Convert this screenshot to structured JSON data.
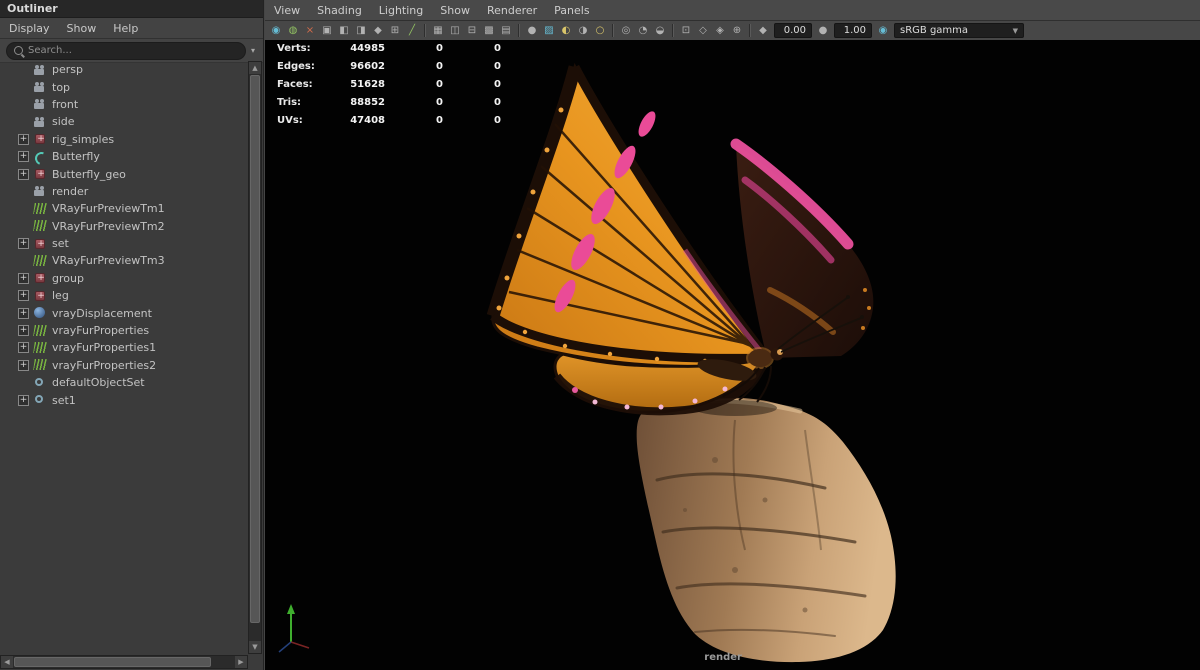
{
  "colors": {
    "ui_background": "#454545",
    "panel_background": "#3b3b3b",
    "input_background": "#242424",
    "viewport_background": "#000000",
    "text": "#c9c9c9",
    "butterfly_orange": "#e8951f",
    "butterfly_pink": "#e84f9b",
    "rock_tan": "#c9a277",
    "axis_green": "#3fae2e"
  },
  "glyphs": {
    "up": "▲",
    "down": "▼",
    "left": "◀",
    "right": "▶",
    "search_caret": "▾",
    "expander": "+",
    "dropdown_caret": "▼"
  },
  "outliner": {
    "title": "Outliner",
    "menus": [
      "Display",
      "Show",
      "Help"
    ],
    "search_placeholder": "Search...",
    "items": [
      {
        "label": "persp",
        "icon": "camera",
        "indent": 2,
        "expandable": false
      },
      {
        "label": "top",
        "icon": "camera",
        "indent": 2,
        "expandable": false
      },
      {
        "label": "front",
        "icon": "camera",
        "indent": 2,
        "expandable": false
      },
      {
        "label": "side",
        "icon": "camera",
        "indent": 2,
        "expandable": false
      },
      {
        "label": "rig_simples",
        "icon": "transform",
        "indent": 1,
        "expandable": true
      },
      {
        "label": "Butterfly",
        "icon": "curve",
        "indent": 1,
        "expandable": true
      },
      {
        "label": "Butterfly_geo",
        "icon": "transform",
        "indent": 1,
        "expandable": true
      },
      {
        "label": "render",
        "icon": "camera",
        "indent": 2,
        "expandable": false
      },
      {
        "label": "VRayFurPreviewTm1",
        "icon": "fur",
        "indent": 2,
        "expandable": false
      },
      {
        "label": "VRayFurPreviewTm2",
        "icon": "fur",
        "indent": 2,
        "expandable": false
      },
      {
        "label": "set",
        "icon": "transform",
        "indent": 1,
        "expandable": true
      },
      {
        "label": "VRayFurPreviewTm3",
        "icon": "fur",
        "indent": 2,
        "expandable": false
      },
      {
        "label": "group",
        "icon": "transform",
        "indent": 1,
        "expandable": true
      },
      {
        "label": "leg",
        "icon": "transform",
        "indent": 1,
        "expandable": true
      },
      {
        "label": "vrayDisplacement",
        "icon": "displacement",
        "indent": 1,
        "expandable": true
      },
      {
        "label": "vrayFurProperties",
        "icon": "fur",
        "indent": 1,
        "expandable": true
      },
      {
        "label": "vrayFurProperties1",
        "icon": "fur",
        "indent": 1,
        "expandable": true
      },
      {
        "label": "vrayFurProperties2",
        "icon": "fur",
        "indent": 1,
        "expandable": true
      },
      {
        "label": "defaultObjectSet",
        "icon": "objectset",
        "indent": 2,
        "expandable": false
      },
      {
        "label": "set1",
        "icon": "objectset",
        "indent": 1,
        "expandable": true
      }
    ]
  },
  "viewport": {
    "menus": [
      "View",
      "Shading",
      "Lighting",
      "Show",
      "Renderer",
      "Panels"
    ],
    "toolbar": [
      {
        "t": "icon",
        "name": "renderer-sphere-icon",
        "glyph": "◉",
        "c": "teal"
      },
      {
        "t": "icon",
        "name": "smooth-shade-icon",
        "glyph": "◍",
        "c": "green"
      },
      {
        "t": "icon",
        "name": "no-texture-icon",
        "glyph": "×",
        "c": "red"
      },
      {
        "t": "icon",
        "name": "select-camera-icon",
        "glyph": "▣"
      },
      {
        "t": "icon",
        "name": "lock-camera-icon",
        "glyph": "◧"
      },
      {
        "t": "icon",
        "name": "image-plane-icon",
        "glyph": "◨"
      },
      {
        "t": "icon",
        "name": "bookmark-icon",
        "glyph": "◆"
      },
      {
        "t": "icon",
        "name": "pan-zoom-icon",
        "glyph": "⊞"
      },
      {
        "t": "icon",
        "name": "grease-pencil-icon",
        "glyph": "╱",
        "c": "green"
      },
      {
        "t": "sep"
      },
      {
        "t": "icon",
        "name": "grid-icon",
        "glyph": "▦"
      },
      {
        "t": "icon",
        "name": "film-gate-icon",
        "glyph": "◫"
      },
      {
        "t": "icon",
        "name": "resolution-gate-icon",
        "glyph": "⊟"
      },
      {
        "t": "icon",
        "name": "gate-mask-icon",
        "glyph": "▩"
      },
      {
        "t": "icon",
        "name": "field-chart-icon",
        "glyph": "▤"
      },
      {
        "t": "sep"
      },
      {
        "t": "icon",
        "name": "default-material-icon",
        "glyph": "●"
      },
      {
        "t": "icon",
        "name": "textured-icon",
        "glyph": "▨",
        "c": "teal"
      },
      {
        "t": "icon",
        "name": "use-all-lights-icon",
        "glyph": "◐",
        "c": "yellow"
      },
      {
        "t": "icon",
        "name": "shadows-icon",
        "glyph": "◑"
      },
      {
        "t": "icon",
        "name": "light-bulb-icon",
        "glyph": "○",
        "c": "yellow"
      },
      {
        "t": "sep"
      },
      {
        "t": "icon",
        "name": "ssao-icon",
        "glyph": "◎"
      },
      {
        "t": "icon",
        "name": "motion-blur-icon",
        "glyph": "◔"
      },
      {
        "t": "icon",
        "name": "multisample-icon",
        "glyph": "◒"
      },
      {
        "t": "sep"
      },
      {
        "t": "icon",
        "name": "isolate-select-icon",
        "glyph": "⊡"
      },
      {
        "t": "icon",
        "name": "xray-icon",
        "glyph": "◇"
      },
      {
        "t": "icon",
        "name": "xray-joints-icon",
        "glyph": "◈"
      },
      {
        "t": "icon",
        "name": "wireframe-on-shaded-icon",
        "glyph": "⊕"
      },
      {
        "t": "sep"
      },
      {
        "t": "icon",
        "name": "exposure-icon",
        "glyph": "◆"
      },
      {
        "t": "field",
        "name": "exposure-field",
        "value": "0.00"
      },
      {
        "t": "icon",
        "name": "gamma-icon",
        "glyph": "●"
      },
      {
        "t": "field",
        "name": "gamma-field",
        "value": "1.00"
      },
      {
        "t": "icon",
        "name": "view-transform-icon",
        "glyph": "◉",
        "c": "teal"
      },
      {
        "t": "select",
        "name": "view-transform-select",
        "value": "sRGB gamma"
      }
    ],
    "hud": {
      "rows": [
        {
          "label": "Verts:",
          "values": [
            "44985",
            "0",
            "0"
          ]
        },
        {
          "label": "Edges:",
          "values": [
            "96602",
            "0",
            "0"
          ]
        },
        {
          "label": "Faces:",
          "values": [
            "51628",
            "0",
            "0"
          ]
        },
        {
          "label": "Tris:",
          "values": [
            "88852",
            "0",
            "0"
          ]
        },
        {
          "label": "UVs:",
          "values": [
            "47408",
            "0",
            "0"
          ]
        }
      ]
    },
    "camera_label": "render"
  }
}
